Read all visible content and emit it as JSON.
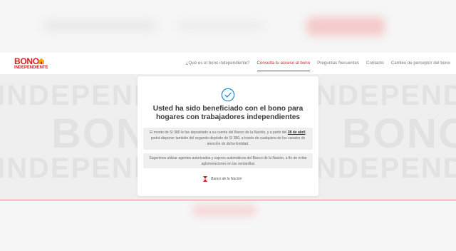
{
  "header": {
    "logo_title": "BONO",
    "logo_subtitle": "INDEPENDIENTE",
    "nav": [
      {
        "label": "¿Qué es el bono independiente?"
      },
      {
        "label": "Consulta tu acceso al bono"
      },
      {
        "label": "Preguntas frecuentes"
      },
      {
        "label": "Contacto"
      },
      {
        "label": "Cambio de perceptor del bono"
      }
    ],
    "active_index": 1
  },
  "background": {
    "watermark_word_1": "INDEPENDIENTE",
    "watermark_word_2": "BONO"
  },
  "modal": {
    "title": "Usted ha sido beneficiado con el bono para hogares con trabajadores independientes",
    "message_1_before": "El monto de S/ 380 le fue depositado a su cuenta del Banco de la Nación, y a partir del ",
    "message_1_date": "28 de abril",
    "message_1_after": ", podrá disponer también del segundo depósito de S/ 380, a través de cualquiera de los canales de atención de dicha Entidad.",
    "message_2": "Sugerimos utilizar agentes autorizados y cajeros automáticos del Banco de la Nación, a fin de evitar aglomeraciones en las ventanillas",
    "bank_name": "Banco de la Nación"
  },
  "colors": {
    "brand_red": "#d31f26",
    "check_blue": "#2a8fd6"
  }
}
